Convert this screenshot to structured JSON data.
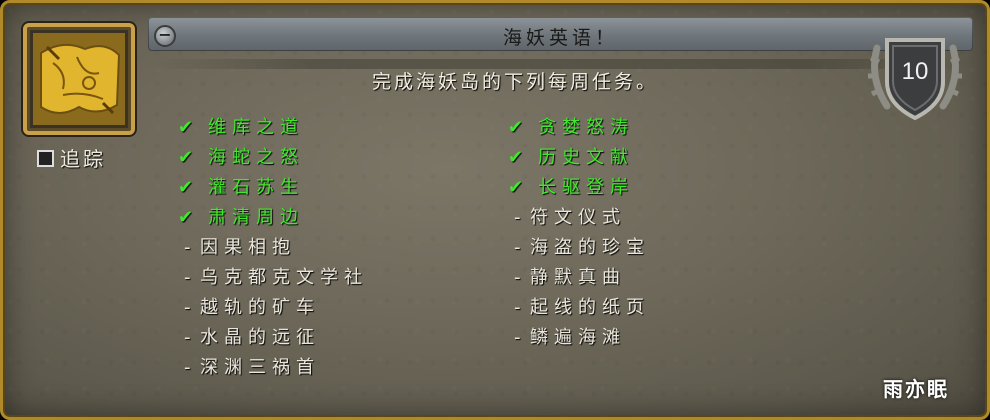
{
  "quest": {
    "title": "海妖英语！",
    "subtitle": "完成海妖岛的下列每周任务。",
    "track_label": "追踪",
    "level_badge": "10",
    "icon": "scroll-map-icon"
  },
  "left_tasks": [
    {
      "label": "维库之道",
      "done": true
    },
    {
      "label": "海蛇之怒",
      "done": true
    },
    {
      "label": "灌石苏生",
      "done": true
    },
    {
      "label": "肃清周边",
      "done": true
    },
    {
      "label": "因果相抱",
      "done": false
    },
    {
      "label": "乌克都克文学社",
      "done": false
    },
    {
      "label": "越轨的矿车",
      "done": false
    },
    {
      "label": "水晶的远征",
      "done": false
    },
    {
      "label": "深渊三祸首",
      "done": false
    }
  ],
  "right_tasks": [
    {
      "label": "贪婪怒涛",
      "done": true
    },
    {
      "label": "历史文献",
      "done": true
    },
    {
      "label": "长驱登岸",
      "done": true
    },
    {
      "label": "符文仪式",
      "done": false
    },
    {
      "label": "海盗的珍宝",
      "done": false
    },
    {
      "label": "静默真曲",
      "done": false
    },
    {
      "label": "起线的纸页",
      "done": false
    },
    {
      "label": "鳞遍海滩",
      "done": false
    }
  ],
  "marks": {
    "check": "✔",
    "dash": "-",
    "collapse": "−"
  },
  "watermark": "雨亦眠",
  "colors": {
    "done": "#3fe82c",
    "todo": "#eae6db",
    "frame": "#b08a2a"
  }
}
